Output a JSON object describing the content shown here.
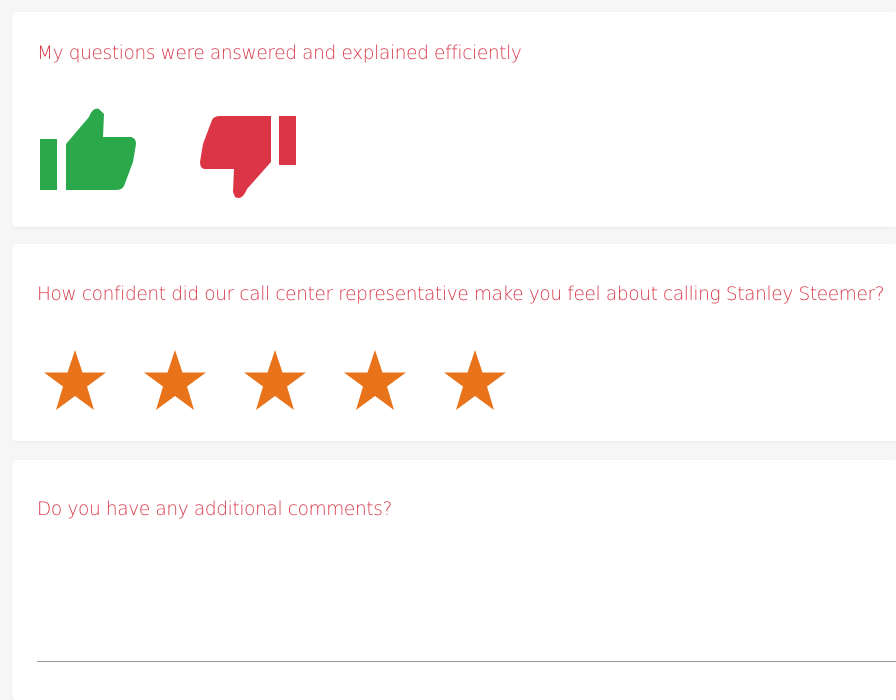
{
  "colors": {
    "question_text": "#d83a4a",
    "thumbs_up": "#2aa84a",
    "thumbs_down": "#dc3545",
    "star": "#e8731b",
    "card_background": "#ffffff",
    "page_background": "#f6f6f6",
    "input_underline": "#9a9a9a"
  },
  "question_1": {
    "text": "My questions were answered and explained efficiently",
    "thumbs_up_icon": "thumbs-up-icon",
    "thumbs_down_icon": "thumbs-down-icon"
  },
  "question_2": {
    "text": "How confident did our call center representative make you feel about calling Stanley Steemer?",
    "rating": 5,
    "max_rating": 5,
    "star_icon": "star-icon"
  },
  "question_3": {
    "text": "Do you have any additional comments?",
    "value": "",
    "placeholder": ""
  }
}
